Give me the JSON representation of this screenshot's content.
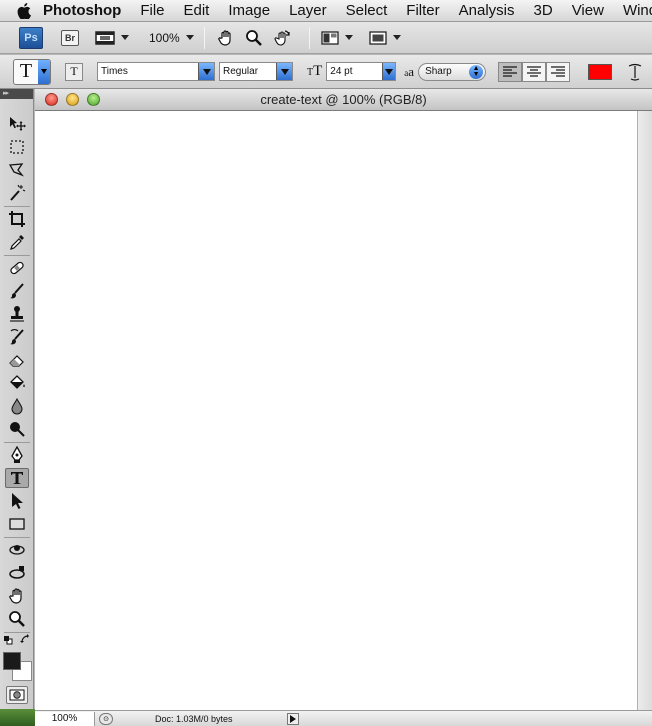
{
  "menubar": {
    "app_name": "Photoshop",
    "items": [
      "File",
      "Edit",
      "Image",
      "Layer",
      "Select",
      "Filter",
      "Analysis",
      "3D",
      "View",
      "Wind"
    ]
  },
  "appbar": {
    "ps_logo": "Ps",
    "bridge_label": "Br",
    "zoom": "100%"
  },
  "options": {
    "tool_glyph": "T",
    "orientation_glyph": "T",
    "font_family": "Times",
    "font_style": "Regular",
    "font_size": "24 pt",
    "aa_glyph": "a",
    "antialias": "Sharp",
    "text_color": "#ff0000"
  },
  "tools": {
    "header": "▸▸",
    "items": [
      "move",
      "marquee",
      "lasso",
      "magic-wand",
      "crop",
      "eyedropper",
      "healing-brush",
      "brush",
      "clone-stamp",
      "history-brush",
      "eraser",
      "paint-bucket",
      "blur",
      "dodge",
      "pen",
      "type",
      "path-selection",
      "rectangle",
      "3d-rotate",
      "3d-orbit",
      "hand",
      "zoom"
    ],
    "active": "type",
    "foreground": "#1a1a1a",
    "background": "#ffffff"
  },
  "document": {
    "title": "create-text @ 100% (RGB/8)",
    "canvas_color": "#ffffff",
    "status_zoom": "100%",
    "doc_info": "Doc: 1.03M/0 bytes"
  }
}
